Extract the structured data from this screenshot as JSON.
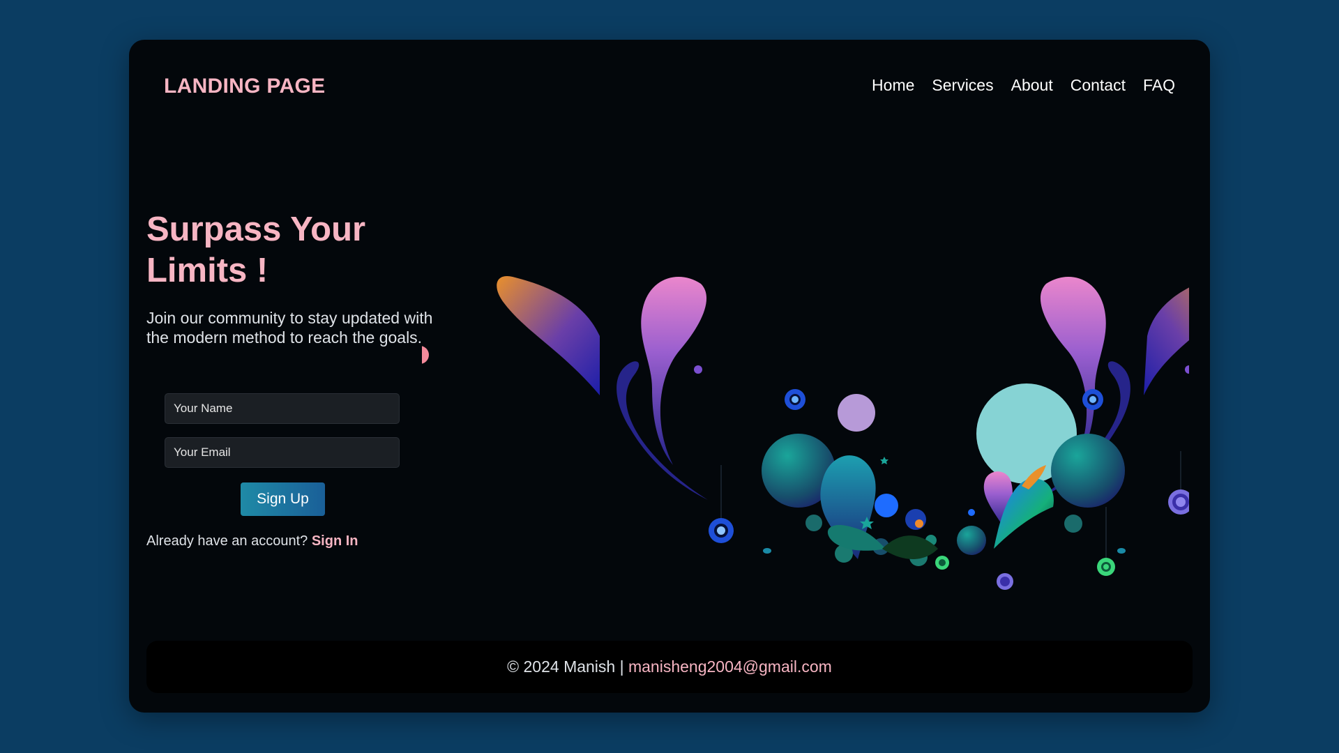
{
  "header": {
    "logo": "LANDING PAGE",
    "nav": [
      "Home",
      "Services",
      "About",
      "Contact",
      "FAQ"
    ]
  },
  "hero": {
    "title_line1": "Surpass Your",
    "title_line2": "Limits !",
    "subtitle": "Join our community to stay updated with the modern method to reach the goals."
  },
  "form": {
    "name_placeholder": "Your Name",
    "email_placeholder": "Your Email",
    "submit_label": "Sign Up",
    "signin_prompt": "Already have an account?",
    "signin_link": "Sign In"
  },
  "footer": {
    "copyright": "© 2024 Manish |",
    "email": "manisheng2004@gmail.com"
  },
  "colors": {
    "page_bg": "#0b3d62",
    "card_bg": "#03070b",
    "accent_pink": "#f7b5c3",
    "button_gradient": [
      "#1f8aa6",
      "#1a5f98"
    ]
  }
}
